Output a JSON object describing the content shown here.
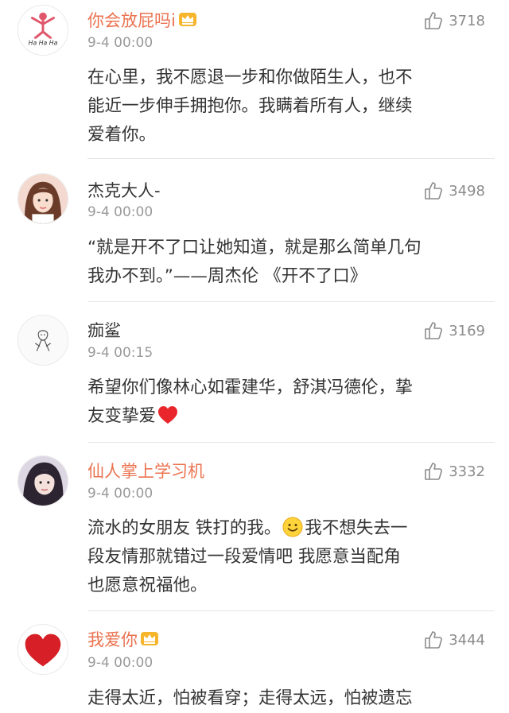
{
  "comments": [
    {
      "username": "你会放屁吗i",
      "vip": true,
      "time": "9-4 00:00",
      "likes": "3718",
      "avatar_icon": "hahaha-figure-avatar",
      "avatar_text": "Ha Ha Ha",
      "lines": [
        "在心里，我不愿退一步和你做陌生人，也不",
        "能近一步伸手拥抱你。我瞒着所有人，继续",
        "爱着你。"
      ]
    },
    {
      "username": "杰克大人-",
      "vip": false,
      "time": "9-4 00:00",
      "likes": "3498",
      "avatar_icon": "girl-photo-avatar",
      "lines": [
        "“就是开不了口让她知道，就是那么简单几句",
        "我办不到。”——周杰伦 《开不了口》"
      ]
    },
    {
      "username": "痂鲨",
      "vip": false,
      "time": "9-4 00:15",
      "likes": "3169",
      "avatar_icon": "sketch-figure-avatar",
      "lines": [
        "希望你们像林心如霍建华，舒淇冯德伦，挚",
        "友变挚爱"
      ]
    },
    {
      "username": "仙人掌上学习机",
      "vip": true,
      "time": "9-4 00:00",
      "likes": "3332",
      "avatar_icon": "girl-portrait-avatar",
      "lines": [
        "流水的女朋友 铁打的我。",
        "我不想失去一",
        "段友情那就错过一段爱情吧 我愿意当配角",
        "也愿意祝福他。"
      ]
    },
    {
      "username": "我爱你",
      "vip": true,
      "time": "9-4 00:00",
      "likes": "3444",
      "avatar_icon": "red-heart-avatar",
      "lines": [
        "走得太近，怕被看穿；走得太远，怕被遗忘"
      ]
    }
  ],
  "icons": {
    "like": "thumbs-up-icon",
    "vip": "crown-badge-icon",
    "heart_emoji": "red-heart-emoji-icon",
    "smile_emoji": "smile-emoji-icon"
  },
  "colors": {
    "vip_name": "#eb7350",
    "plain_name": "#333333",
    "time": "#9a9a9a",
    "divider": "#e6e6e6"
  }
}
